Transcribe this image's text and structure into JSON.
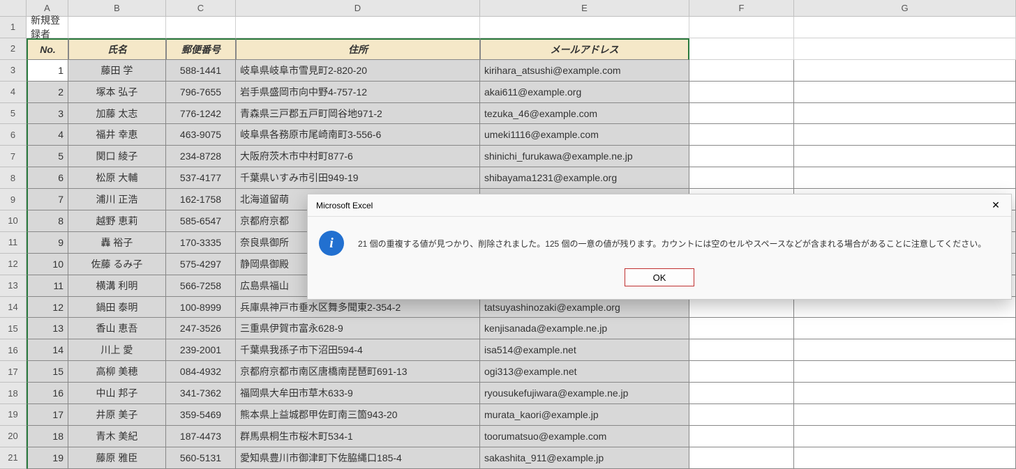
{
  "columns": [
    "A",
    "B",
    "C",
    "D",
    "E",
    "F",
    "G"
  ],
  "title_cell": "新規登録者",
  "headers": {
    "no": "No.",
    "name": "氏名",
    "postal": "郵便番号",
    "address": "住所",
    "email": "メールアドレス"
  },
  "rows": [
    {
      "no": "1",
      "name": "藤田 学",
      "postal": "588-1441",
      "address": "岐阜県岐阜市雪見町2-820-20",
      "email": "kirihara_atsushi@example.com"
    },
    {
      "no": "2",
      "name": "塚本 弘子",
      "postal": "796-7655",
      "address": "岩手県盛岡市向中野4-757-12",
      "email": "akai611@example.org"
    },
    {
      "no": "3",
      "name": "加藤 太志",
      "postal": "776-1242",
      "address": "青森県三戸郡五戸町岡谷地971-2",
      "email": "tezuka_46@example.com"
    },
    {
      "no": "4",
      "name": "福井 幸恵",
      "postal": "463-9075",
      "address": "岐阜県各務原市尾崎南町3-556-6",
      "email": "umeki1116@example.com"
    },
    {
      "no": "5",
      "name": "関口 綾子",
      "postal": "234-8728",
      "address": "大阪府茨木市中村町877-6",
      "email": "shinichi_furukawa@example.ne.jp"
    },
    {
      "no": "6",
      "name": "松原 大輔",
      "postal": "537-4177",
      "address": "千葉県いすみ市引田949-19",
      "email": "shibayama1231@example.org"
    },
    {
      "no": "7",
      "name": "浦川 正浩",
      "postal": "162-1758",
      "address": "北海道留萌",
      "email": ""
    },
    {
      "no": "8",
      "name": "越野 恵莉",
      "postal": "585-6547",
      "address": "京都府京都",
      "email": ""
    },
    {
      "no": "9",
      "name": "轟 裕子",
      "postal": "170-3335",
      "address": "奈良県御所",
      "email": ""
    },
    {
      "no": "10",
      "name": "佐藤 るみ子",
      "postal": "575-4297",
      "address": "静岡県御殿",
      "email": ""
    },
    {
      "no": "11",
      "name": "横溝 利明",
      "postal": "566-7258",
      "address": "広島県福山",
      "email": ""
    },
    {
      "no": "12",
      "name": "鍋田 泰明",
      "postal": "100-8999",
      "address": "兵庫県神戸市垂水区舞多聞東2-354-2",
      "email": "tatsuyashinozaki@example.org"
    },
    {
      "no": "13",
      "name": "香山 恵吾",
      "postal": "247-3526",
      "address": "三重県伊賀市富永628-9",
      "email": "kenjisanada@example.ne.jp"
    },
    {
      "no": "14",
      "name": "川上 愛",
      "postal": "239-2001",
      "address": "千葉県我孫子市下沼田594-4",
      "email": "isa514@example.net"
    },
    {
      "no": "15",
      "name": "高柳 美穂",
      "postal": "084-4932",
      "address": "京都府京都市南区唐橋南琵琶町691-13",
      "email": "ogi313@example.net"
    },
    {
      "no": "16",
      "name": "中山 邦子",
      "postal": "341-7362",
      "address": "福岡県大牟田市草木633-9",
      "email": "ryousukefujiwara@example.ne.jp"
    },
    {
      "no": "17",
      "name": "井原 美子",
      "postal": "359-5469",
      "address": "熊本県上益城郡甲佐町南三箇943-20",
      "email": "murata_kaori@example.jp"
    },
    {
      "no": "18",
      "name": "青木 美紀",
      "postal": "187-4473",
      "address": "群馬県桐生市桜木町534-1",
      "email": "toorumatsuo@example.com"
    },
    {
      "no": "19",
      "name": "藤原 雅臣",
      "postal": "560-5131",
      "address": "愛知県豊川市御津町下佐脇縄口185-4",
      "email": "sakashita_911@example.jp"
    }
  ],
  "dialog": {
    "title": "Microsoft Excel",
    "message": "21 個の重複する値が見つかり、削除されました。125 個の一意の値が残ります。カウントには空のセルやスペースなどが含まれる場合があることに注意してください。",
    "ok": "OK"
  }
}
